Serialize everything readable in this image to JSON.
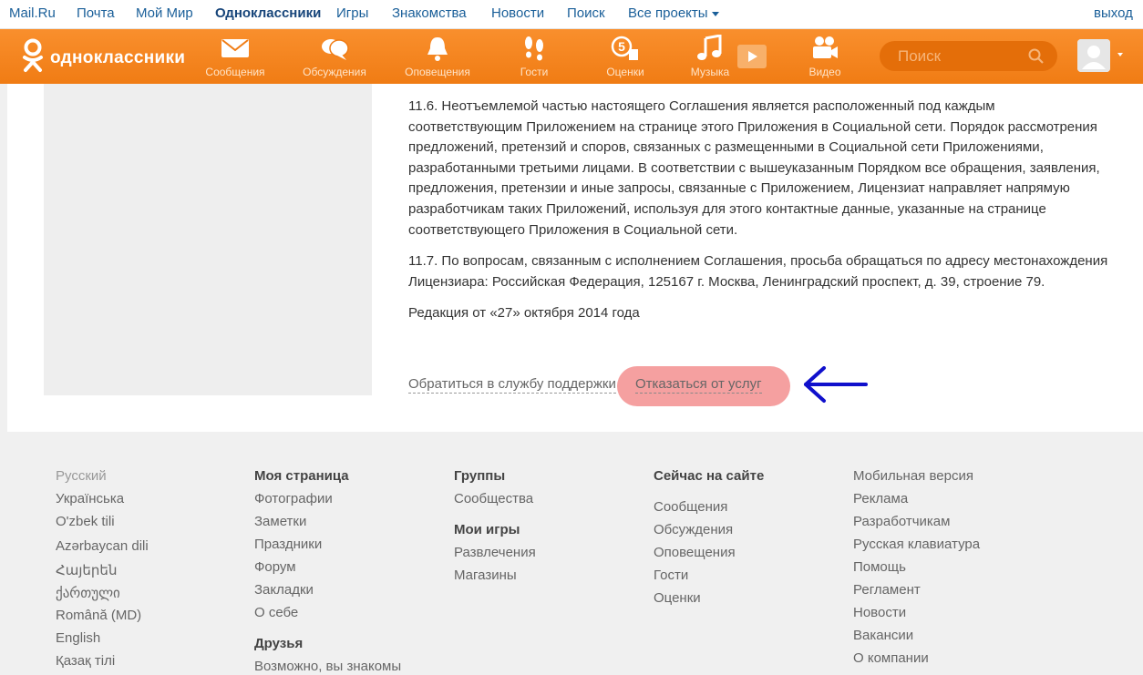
{
  "topbar": {
    "links": [
      "Mail.Ru",
      "Почта",
      "Мой Мир",
      "Одноклассники",
      "Игры",
      "Знакомства",
      "Новости",
      "Поиск",
      "Все проекты"
    ],
    "logout": "выход"
  },
  "header": {
    "logo_text": "одноклассники",
    "nav": [
      "Сообщения",
      "Обсуждения",
      "Оповещения",
      "Гости",
      "Оценки",
      "Музыка",
      "Видео"
    ],
    "search_placeholder": "Поиск",
    "colors": {
      "brand": "#f07c14",
      "refuse_highlight": "#f5a0a0",
      "arrow": "#1010cc"
    }
  },
  "agreement": {
    "p1": "11.6. Неотъемлемой частью настоящего Соглашения является расположенный под каждым соответствующим Приложением на странице этого Приложения в Социальной сети. Порядок рассмотрения предложений, претензий и споров, связанных с размещенными в Социальной сети Приложениями, разработанными третьими лицами. В соответствии с вышеуказанным Порядком все обращения, заявления, предложения, претензии и иные запросы, связанные с Приложением, Лицензиат направляет напрямую разработчикам таких Приложений, используя для этого контактные данные, указанные на странице соответствующего Приложения в Социальной сети.",
    "p2": "11.7. По вопросам, связанным с исполнением Соглашения, просьба обращаться по адресу местонахождения Лицензиара: Российская Федерация, 125167 г. Москва, Ленинградский проспект, д. 39, строение 79.",
    "p3": "Редакция от «27» октября 2014 года",
    "support_link": "Обратиться в службу поддержки",
    "refuse_link": "Отказаться от услуг"
  },
  "footer": {
    "languages": [
      "Русский",
      "Українська",
      "O'zbek tili",
      "Azərbaycan dili",
      "Հայերեն",
      "ქართული",
      "Română (MD)",
      "English",
      "Қазақ тілі"
    ],
    "my_page": {
      "title": "Моя страница",
      "items": [
        "Фотографии",
        "Заметки",
        "Праздники",
        "Форум",
        "Закладки",
        "О себе"
      ],
      "friends_title": "Друзья",
      "friends_items": [
        "Возможно, вы знакомы"
      ]
    },
    "groups": {
      "title": "Группы",
      "items": [
        "Сообщества"
      ],
      "games_title": "Мои игры",
      "games_items": [
        "Развлечения",
        "Магазины"
      ]
    },
    "now_on_site": {
      "title": "Сейчас на сайте",
      "items": [
        "Сообщения",
        "Обсуждения",
        "Оповещения",
        "Гости",
        "Оценки"
      ]
    },
    "misc": [
      "Мобильная версия",
      "Реклама",
      "Разработчикам",
      "Русская клавиатура",
      "Помощь",
      "Регламент",
      "Новости",
      "Вакансии",
      "О компании"
    ]
  }
}
